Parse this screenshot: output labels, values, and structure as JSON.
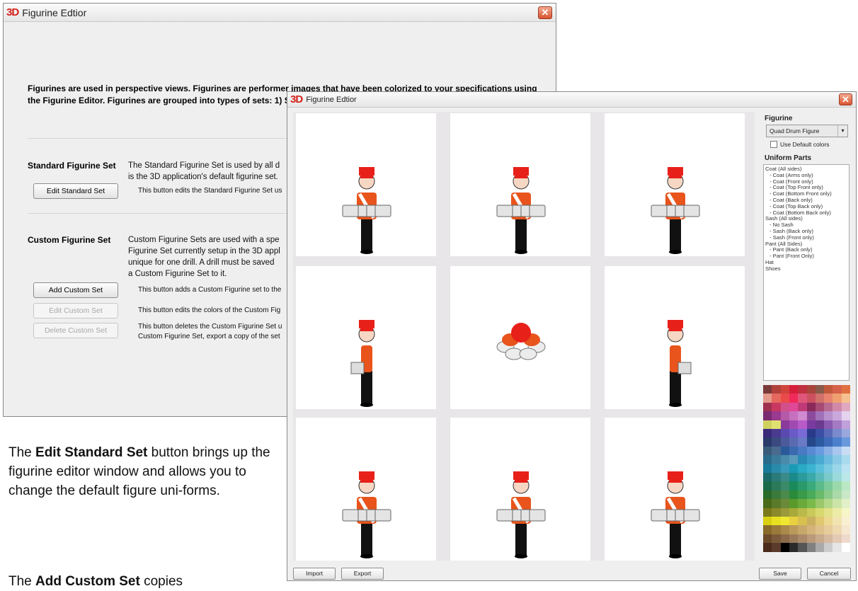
{
  "win1": {
    "logo": "3D",
    "title": "Figurine Edtior",
    "intro": "Figurines are used in perspective views.  Figurines are performer images that have been colorized to your specifications using the Figurine Editor.  Figurines are grouped into types of sets: 1) Sta",
    "standard": {
      "heading": "Standard Figurine Set",
      "line1": "The Standard Figurine Set is used by all d",
      "line2": "is the 3D application's default figurine set.",
      "button": "Edit Standard Set",
      "button_desc": "This button edits the Standard Figurine Set us"
    },
    "custom": {
      "heading": "Custom Figurine Set",
      "line1": "Custom Figurine Sets are used with a spe",
      "line2": "Figurine Set currently setup in the 3D appl",
      "line3": "unique for one drill.  A drill must be saved",
      "line4": "a Custom Figurine Set to it.",
      "add_button": "Add Custom Set",
      "add_desc": "This button adds a Custom Figurine set to the",
      "edit_button": "Edit Custom Set",
      "edit_desc": "This button edits the colors of the Custom Fig",
      "delete_button": "Delete Custom Set",
      "delete_desc1": "This button deletes the Custom Figurine Set u",
      "delete_desc2": "Custom Figurine Set, export a copy of the set"
    }
  },
  "doc": {
    "p1_a": "The ",
    "p1_b": "Edit Standard Set",
    "p1_c": " button brings up the figurine editor window and allows you to change the default figure uni-forms.",
    "p2_a": "The ",
    "p2_b": "Add Custom Set",
    "p2_c": " copies"
  },
  "win2": {
    "logo": "3D",
    "title": "Figurine Edtior",
    "figurine_label": "Figurine",
    "figurine_value": "Quad Drum Figure",
    "use_default": "Use Default colors",
    "uniform_label": "Uniform Parts",
    "parts": [
      {
        "t": "Coat (All sides)",
        "sub": false
      },
      {
        "t": "- Coat (Arms only)",
        "sub": true
      },
      {
        "t": "- Coat (Front only)",
        "sub": true
      },
      {
        "t": "- Coat (Top Front only)",
        "sub": true
      },
      {
        "t": "- Coat (Bottom Front only)",
        "sub": true
      },
      {
        "t": "- Coat (Back only)",
        "sub": true
      },
      {
        "t": "- Coat (Top Back only)",
        "sub": true
      },
      {
        "t": "- Coat (Bottom Back only)",
        "sub": true
      },
      {
        "t": "Sash (All sides)",
        "sub": false
      },
      {
        "t": "- No Sash",
        "sub": true
      },
      {
        "t": "- Sash (Back only)",
        "sub": true
      },
      {
        "t": "- Sash (Front only)",
        "sub": true
      },
      {
        "t": "Pant (All Sides)",
        "sub": false
      },
      {
        "t": "- Pant (Back only)",
        "sub": true
      },
      {
        "t": "- Pant (Front Only)",
        "sub": true
      },
      {
        "t": "Hat",
        "sub": false
      },
      {
        "t": "Shoes",
        "sub": false
      }
    ],
    "import": "Import",
    "export": "Export",
    "save": "Save",
    "cancel": "Cancel",
    "colors": {
      "coat": "#e8541c",
      "hat": "#e8201a",
      "pants": "#111111",
      "face": "#f6d7c4",
      "drum": "#d9d9d9"
    },
    "palette": [
      "#7a3a3a",
      "#b2403a",
      "#d0443c",
      "#d61e3a",
      "#c03040",
      "#a8453c",
      "#8a5a4a",
      "#c0583c",
      "#d6604a",
      "#e07040",
      "#e49a8c",
      "#e6685e",
      "#ea4a4a",
      "#f02a5a",
      "#e0567a",
      "#cc5060",
      "#d0706a",
      "#e8846e",
      "#f0a070",
      "#f6c090",
      "#a03050",
      "#c83860",
      "#d2508a",
      "#e04898",
      "#c03a78",
      "#8a2a5a",
      "#a64a74",
      "#b86a90",
      "#d08aa8",
      "#e0a8c0",
      "#7a2a70",
      "#9a3a90",
      "#b45aa8",
      "#c870c0",
      "#d08ad0",
      "#8c4a9c",
      "#a070b8",
      "#b890cc",
      "#caa8dc",
      "#e4d2ee",
      "#cfd060",
      "#e0e070",
      "#8a3a9a",
      "#a04ab0",
      "#b85ac8",
      "#7a3aa0",
      "#6a3a90",
      "#8a5ab0",
      "#a47ac4",
      "#c0a0da",
      "#3a2a7a",
      "#4a3a90",
      "#5a4ab0",
      "#6a5ac8",
      "#7a6ad8",
      "#2a3a8a",
      "#3a4ea4",
      "#5a6ab8",
      "#7a8acc",
      "#9aa8de",
      "#2a3a6a",
      "#3a4a80",
      "#4a5a9a",
      "#5a6ab0",
      "#6a7ac4",
      "#24488a",
      "#2c5aa0",
      "#3c6ab8",
      "#4c80cc",
      "#6a98dc",
      "#3a5a7a",
      "#4a6a90",
      "#2a5a9a",
      "#3a6ab0",
      "#4a7ac4",
      "#5a8ad4",
      "#6a9ae0",
      "#8ab0e6",
      "#a8c6ee",
      "#c8dcf4",
      "#2a6a8a",
      "#3a7a9a",
      "#4a8aaa",
      "#5a9aba",
      "#2a8ab4",
      "#3a9ac4",
      "#4aaad2",
      "#6abade",
      "#8acae6",
      "#aadaee",
      "#1a7a9a",
      "#2a8aaa",
      "#3a9aba",
      "#1a9ab4",
      "#2aaac4",
      "#3ab4d0",
      "#5ac0da",
      "#7acae2",
      "#9ad6ea",
      "#bae2f2",
      "#1a6a6a",
      "#2a7a7a",
      "#3a8a8a",
      "#1a8a8a",
      "#2a9a9a",
      "#3aaaaa",
      "#5ababa",
      "#7acaca",
      "#9adada",
      "#bae8e8",
      "#1a6a4a",
      "#2a7a5a",
      "#3a8a6a",
      "#1a8a5a",
      "#2a9a6a",
      "#3aaa7a",
      "#5aba8a",
      "#7aca9a",
      "#9adaaa",
      "#bae8c4",
      "#2a6a2a",
      "#3a7a3a",
      "#4a8a4a",
      "#2a8a3a",
      "#3a9a4a",
      "#4aaa5a",
      "#6aba6a",
      "#8aca8a",
      "#aadaaa",
      "#cae8c8",
      "#4a6a1a",
      "#5a7a2a",
      "#6a8a3a",
      "#5a9a2a",
      "#6aaa3a",
      "#7aba4a",
      "#9ac86a",
      "#b4d88a",
      "#cce4a8",
      "#e2f0c8",
      "#7a7a1a",
      "#8a8a2a",
      "#9a9a3a",
      "#aaaa3a",
      "#baba4a",
      "#caca5a",
      "#d8d870",
      "#e2e28a",
      "#ececa8",
      "#f6f6c8",
      "#d8d010",
      "#e8e020",
      "#f0e830",
      "#e8d040",
      "#d8c050",
      "#c8b060",
      "#e0c870",
      "#ecd890",
      "#f2e4b0",
      "#f8f0d0",
      "#8a6a2a",
      "#9a7a3a",
      "#aa8a4a",
      "#ba9a5a",
      "#c8a86a",
      "#d4b47a",
      "#deC08a",
      "#e6cc9a",
      "#eed8b0",
      "#f6e8d0",
      "#6a4a2a",
      "#7a5a3a",
      "#8a6a4a",
      "#9a7a5a",
      "#aa8a6a",
      "#ba9a7a",
      "#c8aa8c",
      "#d6baa0",
      "#e2cab4",
      "#eedacc",
      "#4a2a1a",
      "#5a3a2a",
      "#000000",
      "#2a2a2a",
      "#555555",
      "#808080",
      "#aaaaaa",
      "#cccccc",
      "#e6e6e6",
      "#ffffff"
    ]
  }
}
